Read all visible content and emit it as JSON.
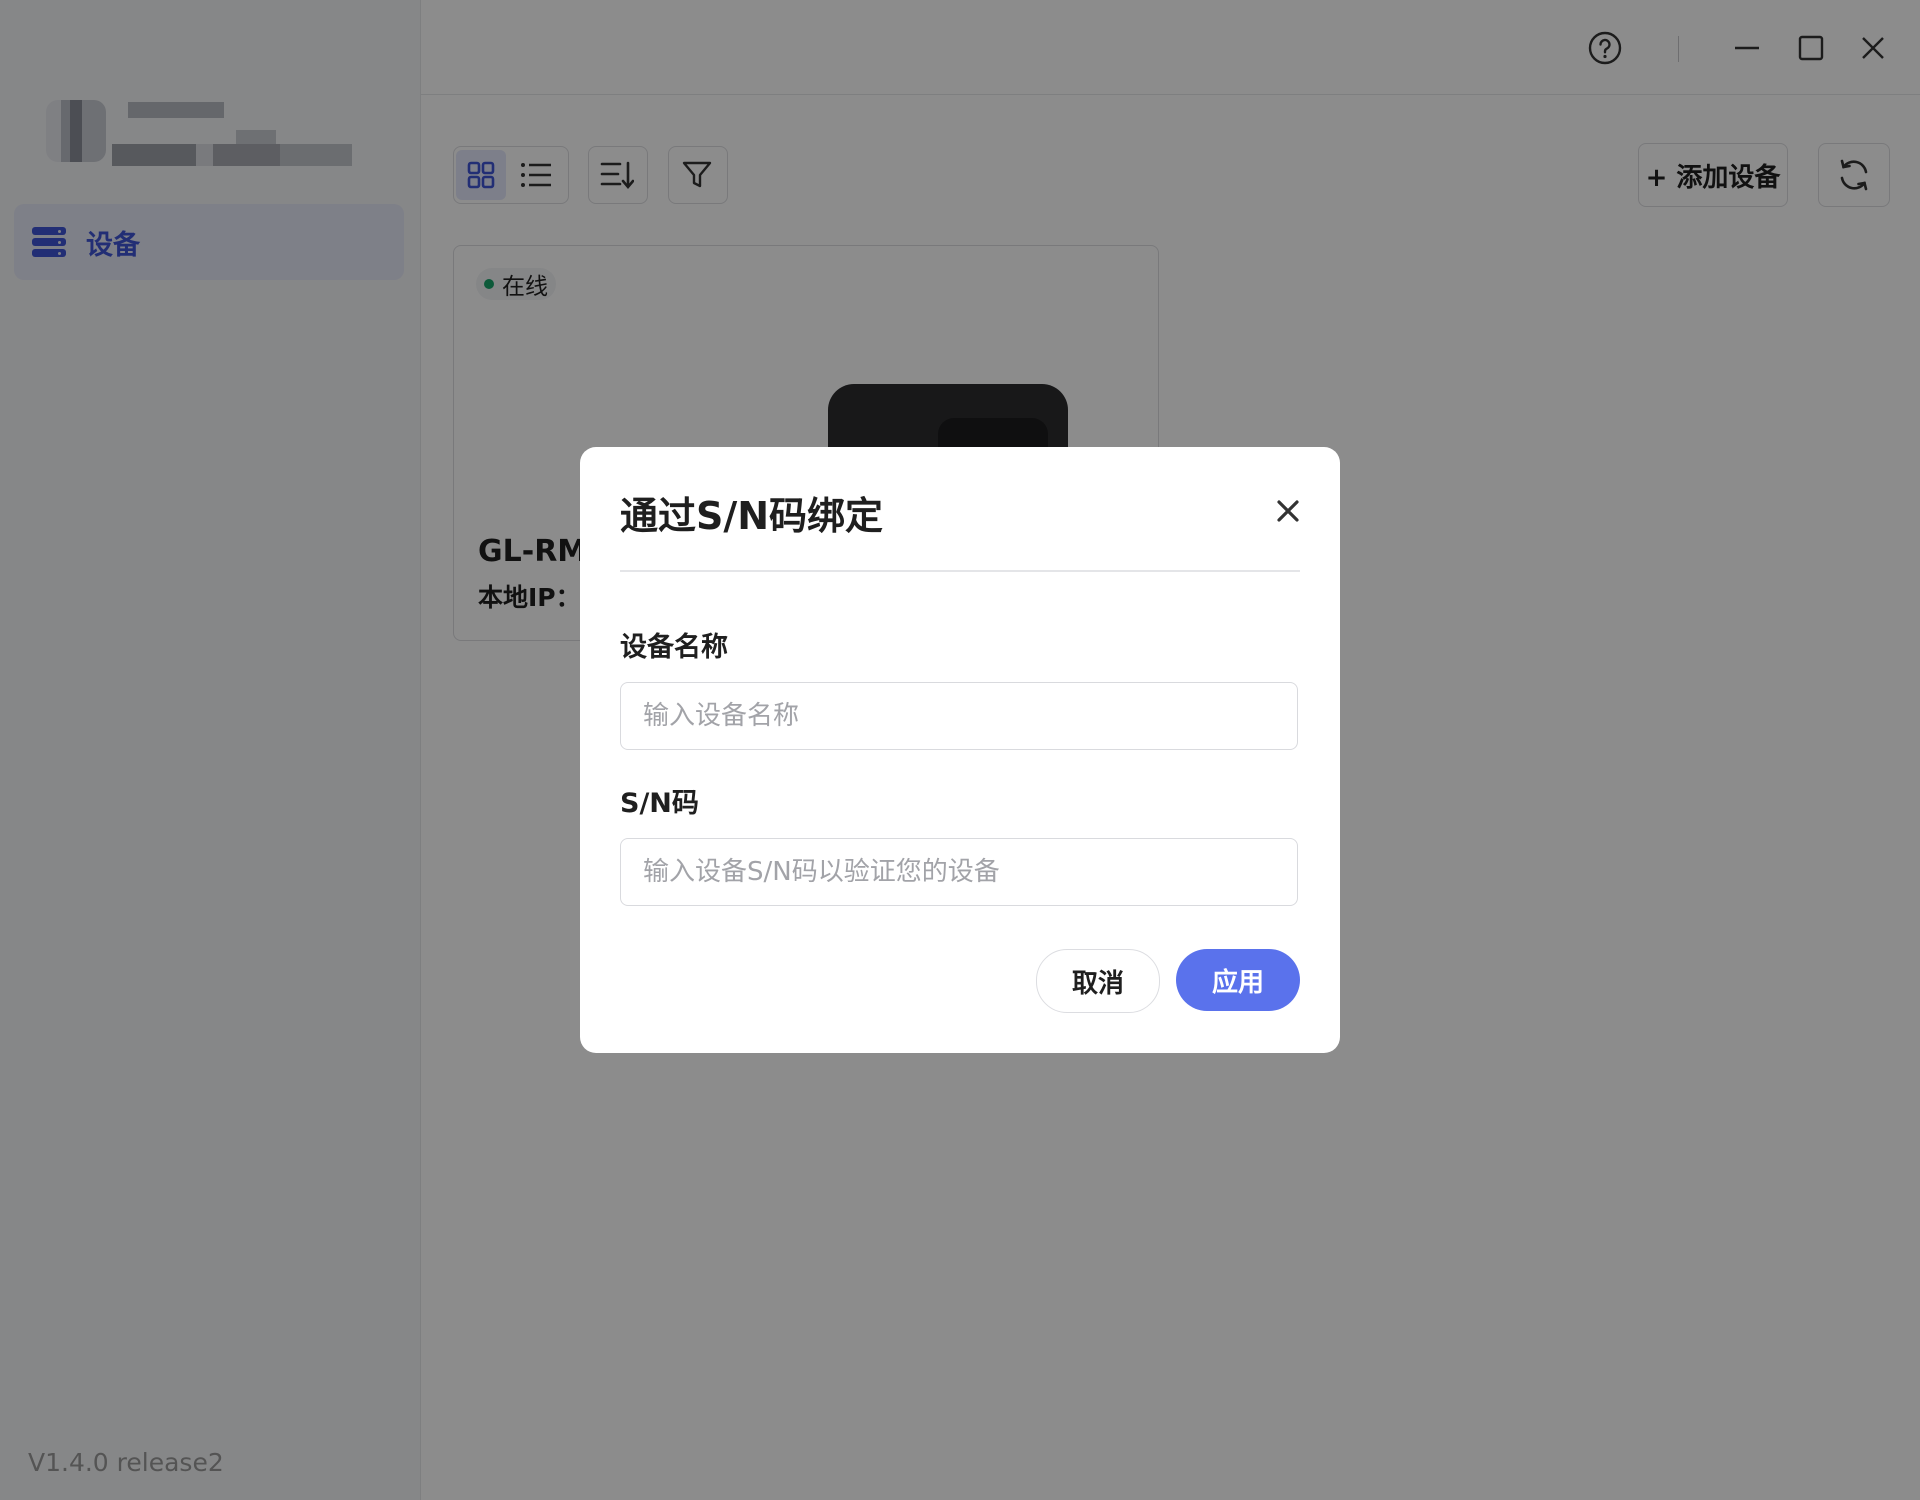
{
  "window": {
    "help_icon": "help-circle-icon",
    "minimize_icon": "minimize-icon",
    "maximize_icon": "maximize-icon",
    "close_icon": "close-icon"
  },
  "sidebar": {
    "items": [
      {
        "label": "设备",
        "icon": "server-icon",
        "active": true
      }
    ],
    "version": "V1.4.0 release2"
  },
  "toolbar": {
    "view_grid_icon": "grid-view-icon",
    "view_list_icon": "list-view-icon",
    "sort_icon": "sort-icon",
    "filter_icon": "filter-icon",
    "add_device_label": "+ 添加设备",
    "refresh_icon": "refresh-icon"
  },
  "devices": [
    {
      "status": "在线",
      "name": "GL-RM",
      "ip_label": "本地IP："
    }
  ],
  "dialog": {
    "title": "通过S/N码绑定",
    "name_label": "设备名称",
    "name_placeholder": "输入设备名称",
    "name_value": "",
    "sn_label": "S/N码",
    "sn_placeholder": "输入设备S/N码以验证您的设备",
    "sn_value": "",
    "cancel_label": "取消",
    "apply_label": "应用"
  },
  "colors": {
    "accent": "#5a72ec",
    "nav_active": "#3e55d6",
    "online": "#18a46b"
  }
}
